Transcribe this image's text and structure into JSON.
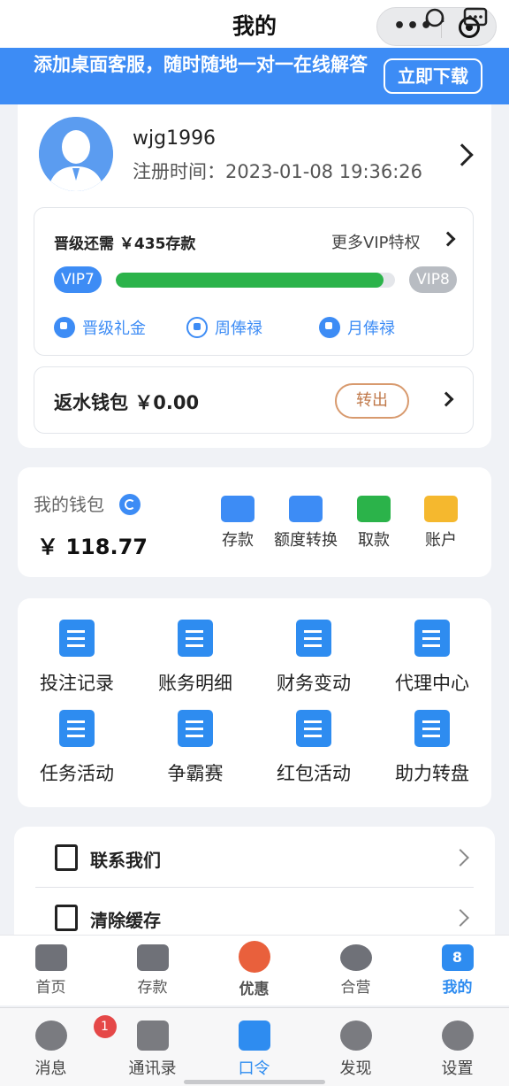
{
  "header": {
    "title": "我的"
  },
  "banner": {
    "text": "添加桌面客服，随时随地一对一在线解答",
    "download_label": "立即下载"
  },
  "profile": {
    "username": "wjg1996",
    "reg_label": "注册时间：",
    "reg_time": "2023-01-08 19:36:26"
  },
  "vip": {
    "upgrade_text": "晋级还需 ￥435存款",
    "more_label": "更多VIP特权",
    "current_level": "VIP7",
    "next_level": "VIP8",
    "progress": 0.96,
    "perks": [
      "晋级礼金",
      "周俸禄",
      "月俸禄"
    ]
  },
  "rebate": {
    "label": "返水钱包 ￥0.00",
    "button": "转出"
  },
  "wallet": {
    "title": "我的钱包",
    "amount": "￥ 118.77",
    "actions": [
      {
        "label": "存款",
        "icon": "wallet-icon",
        "color": "#3d8cf5"
      },
      {
        "label": "额度转换",
        "icon": "transfer-icon",
        "color": "#3d8cf5"
      },
      {
        "label": "取款",
        "icon": "withdraw-icon",
        "color": "#2bb34a"
      },
      {
        "label": "账户",
        "icon": "card-icon",
        "color": "#f5b82e"
      }
    ]
  },
  "features": [
    {
      "label": "投注记录",
      "icon": "bet-record-icon"
    },
    {
      "label": "账务明细",
      "icon": "account-detail-icon"
    },
    {
      "label": "财务变动",
      "icon": "finance-change-icon"
    },
    {
      "label": "代理中心",
      "icon": "agent-icon"
    },
    {
      "label": "任务活动",
      "icon": "task-icon"
    },
    {
      "label": "争霸赛",
      "icon": "contest-icon"
    },
    {
      "label": "红包活动",
      "icon": "red-packet-icon"
    },
    {
      "label": "助力转盘",
      "icon": "wheel-icon"
    }
  ],
  "settings": [
    {
      "label": "联系我们",
      "icon": "contact-icon"
    },
    {
      "label": "清除缓存",
      "icon": "trash-icon"
    }
  ],
  "tabs": [
    {
      "label": "首页",
      "icon": "gamepad-icon"
    },
    {
      "label": "存款",
      "icon": "wallet-icon"
    },
    {
      "label": "优惠",
      "icon": "gift-icon"
    },
    {
      "label": "合营",
      "icon": "partner-icon"
    },
    {
      "label": "我的",
      "icon": "jersey-icon",
      "number": "8"
    }
  ],
  "bottom_tabs": [
    {
      "label": "消息",
      "icon": "message-icon",
      "badge": "1"
    },
    {
      "label": "通讯录",
      "icon": "contacts-icon"
    },
    {
      "label": "口令",
      "icon": "key-icon"
    },
    {
      "label": "发现",
      "icon": "compass-icon"
    },
    {
      "label": "设置",
      "icon": "gear-icon"
    }
  ],
  "colors": {
    "primary": "#3d8cf5",
    "progress": "#2bb34a",
    "badge": "#e54848"
  }
}
